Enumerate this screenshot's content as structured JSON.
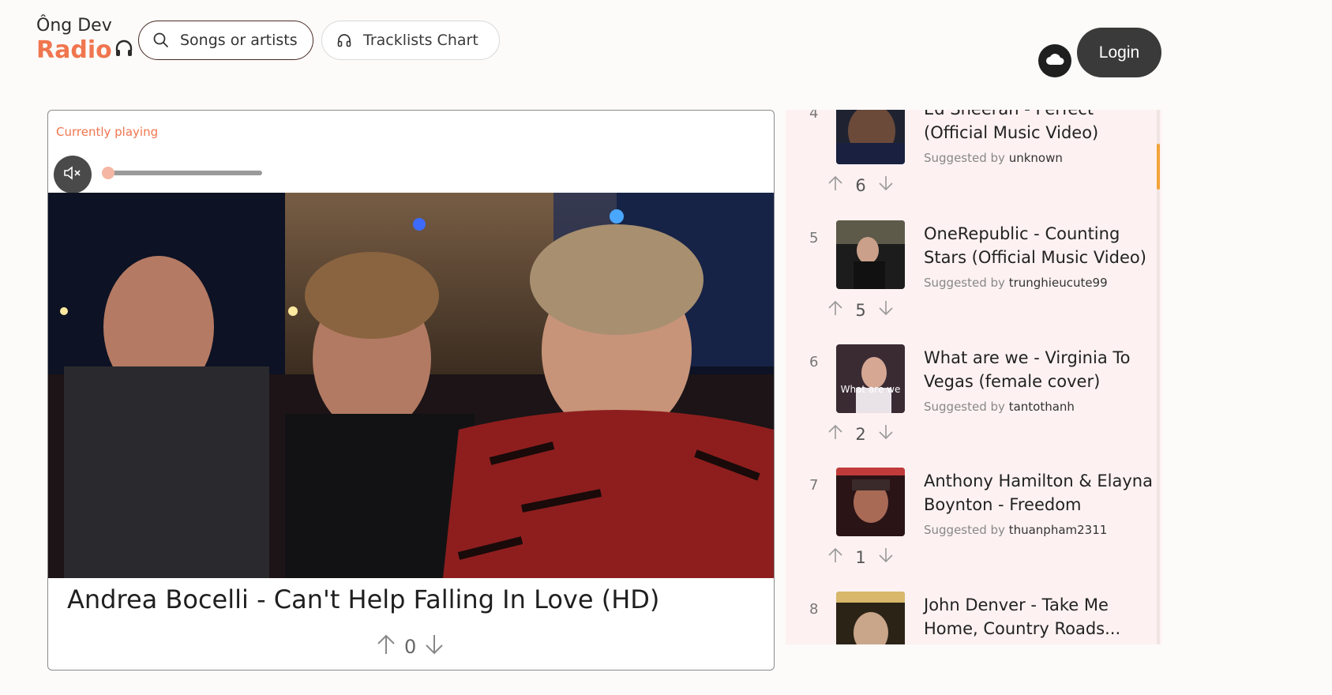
{
  "brand": {
    "line1": "Ông Dev",
    "line2": "Radio"
  },
  "nav": {
    "search_label": "Songs or artists",
    "chart_label": "Tracklists Chart",
    "login_label": "Login"
  },
  "colors": {
    "accent": "#f0764f",
    "queue_bg": "#fdf2f1",
    "scroll_thumb": "#f2a33a"
  },
  "player": {
    "label": "Currently playing",
    "volume_level": 0.0,
    "muted": true,
    "song_title": "Andrea Bocelli - Can't Help Falling In Love (HD)",
    "votes": "0"
  },
  "queue": {
    "suggested_prefix": "Suggested by",
    "items": [
      {
        "index": "4",
        "title": "Ed Sheeran - Perfect (Official Music Video)",
        "suggested_by": "unknown",
        "votes": "6"
      },
      {
        "index": "5",
        "title": "OneRepublic - Counting Stars (Official Music Video)",
        "suggested_by": "trunghieucute99",
        "votes": "5"
      },
      {
        "index": "6",
        "title": "What are we - Virginia To Vegas (female cover)",
        "suggested_by": "tantothanh",
        "votes": "2",
        "thumb_text": "What are we"
      },
      {
        "index": "7",
        "title": "Anthony Hamilton & Elayna Boynton - Freedom",
        "suggested_by": "thuanpham2311",
        "votes": "1"
      },
      {
        "index": "8",
        "title": "John Denver - Take Me Home, Country Roads...",
        "suggested_by": "",
        "votes": ""
      }
    ]
  }
}
